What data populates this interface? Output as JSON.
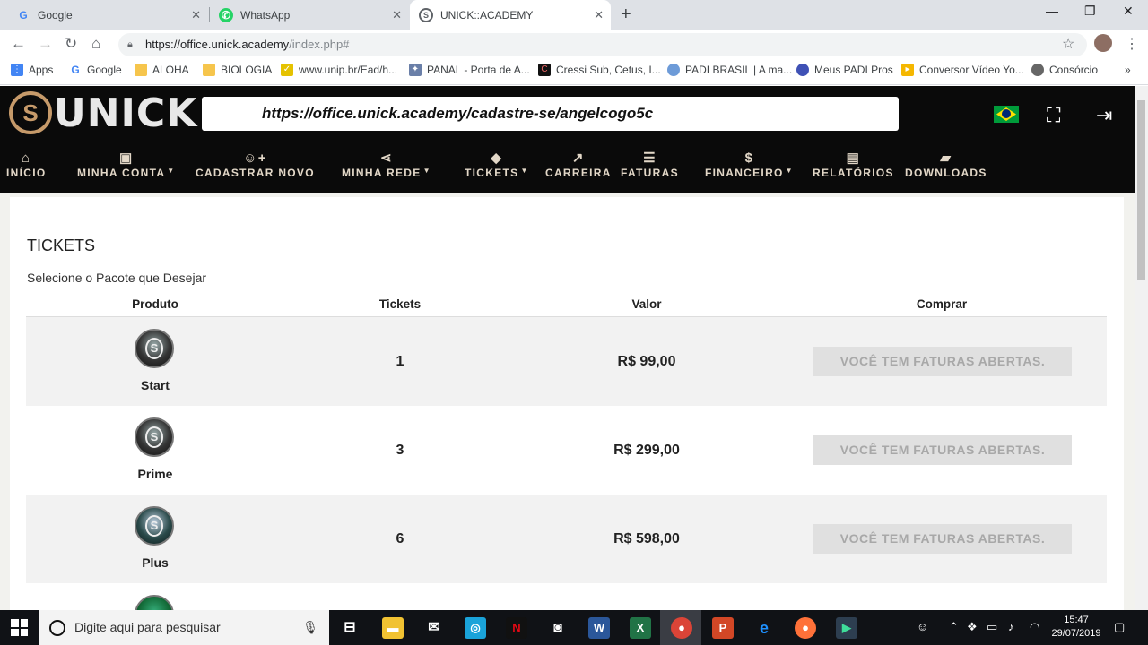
{
  "browser": {
    "tabs": [
      {
        "title": "Google",
        "icon": "google-icon"
      },
      {
        "title": "WhatsApp",
        "icon": "whatsapp-icon"
      },
      {
        "title": "UNICK::ACADEMY",
        "icon": "unick-icon"
      }
    ],
    "url_host": "https://office.unick.academy",
    "url_path": "/index.php#",
    "bookmarks": [
      "Apps",
      "Google",
      "ALOHA",
      "BIOLOGIA",
      "www.unip.br/Ead/h...",
      "PANAL - Porta de A...",
      "Cressi Sub, Cetus, I...",
      "PADI BRASIL | A ma...",
      "Meus PADI Pros",
      "Conversor Vídeo Yo...",
      "Consórcio"
    ]
  },
  "site": {
    "logo_text": "UNICK",
    "referral_link": "https://office.unick.academy/cadastre-se/angelcogo5c",
    "nav": [
      {
        "label": "INÍCIO",
        "icon": "home-icon"
      },
      {
        "label": "MINHA CONTA",
        "icon": "account-icon"
      },
      {
        "label": "CADASTRAR NOVO",
        "icon": "add-user-icon"
      },
      {
        "label": "MINHA REDE",
        "icon": "share-icon"
      },
      {
        "label": "TICKETS",
        "icon": "tag-icon"
      },
      {
        "label": "CARREIRA",
        "icon": "trend-icon"
      },
      {
        "label": "FATURAS",
        "icon": "invoice-icon"
      },
      {
        "label": "FINANCEIRO",
        "icon": "money-icon"
      },
      {
        "label": "RELATÓRIOS",
        "icon": "reports-icon"
      },
      {
        "label": "DOWNLOADS",
        "icon": "briefcase-icon"
      }
    ]
  },
  "tickets": {
    "title": "TICKETS",
    "subtitle": "Selecione o Pacote que Desejar",
    "columns": [
      "Produto",
      "Tickets",
      "Valor",
      "Comprar"
    ],
    "rows": [
      {
        "product": "Start",
        "tickets": "1",
        "value": "R$ 99,00",
        "action": "VOCÊ TEM FATURAS ABERTAS."
      },
      {
        "product": "Prime",
        "tickets": "3",
        "value": "R$ 299,00",
        "action": "VOCÊ TEM FATURAS ABERTAS."
      },
      {
        "product": "Plus",
        "tickets": "6",
        "value": "R$ 598,00",
        "action": "VOCÊ TEM FATURAS ABERTAS."
      }
    ]
  },
  "taskbar": {
    "search_placeholder": "Digite aqui para pesquisar",
    "time": "15:47",
    "date": "29/07/2019"
  }
}
